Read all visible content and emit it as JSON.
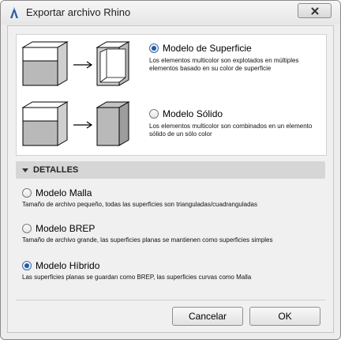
{
  "window": {
    "title": "Exportar archivo Rhino"
  },
  "modes": [
    {
      "label": "Modelo de Superficie",
      "checked": true,
      "description": "Los elementos multicolor son explotados en múltiples elementos basado en su color de superficie"
    },
    {
      "label": "Modelo Sólido",
      "checked": false,
      "description": "Los elementos multicolor son combinados en un elemento sólido de un sólo color"
    }
  ],
  "details": {
    "label": "DETALLES",
    "options": [
      {
        "label": "Modelo Malla",
        "checked": false,
        "description": "Tamaño de archivo pequeño, todas las superficies son trianguladas/cuadranguladas"
      },
      {
        "label": "Modelo BREP",
        "checked": false,
        "description": "Tamaño de archivo grande, las superficies planas se mantienen como superficies simples"
      },
      {
        "label": "Modelo Híbrido",
        "checked": true,
        "description": "Las superficies planas se guardan como BREP, las superficies curvas como Malla"
      }
    ]
  },
  "buttons": {
    "cancel": "Cancelar",
    "ok": "OK"
  }
}
